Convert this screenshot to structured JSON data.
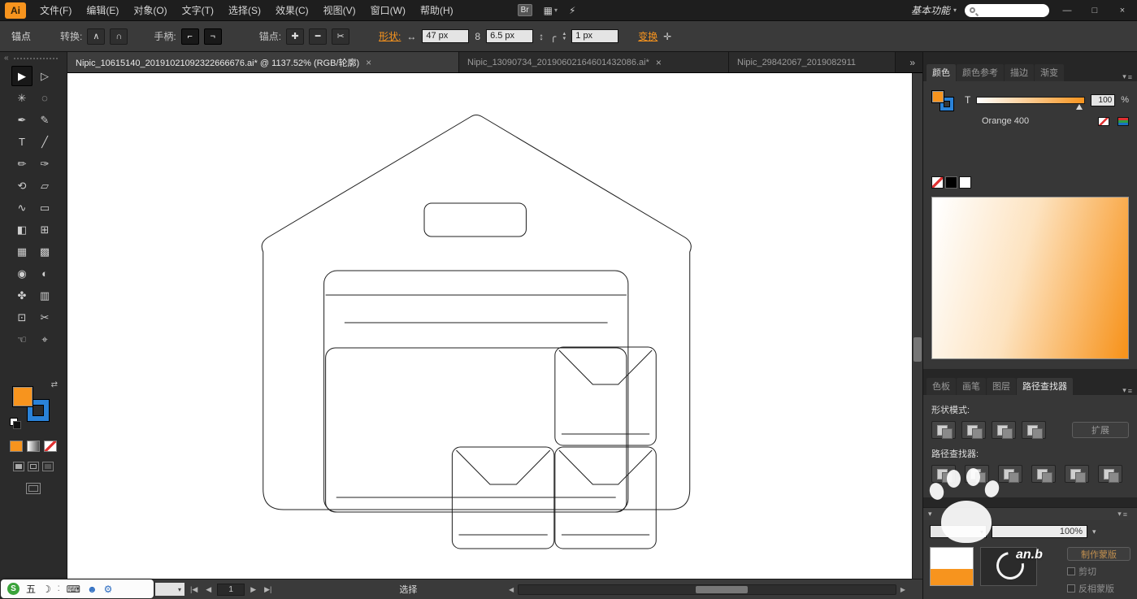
{
  "colors": {
    "accent": "#F7941E",
    "stroke_blue": "#2A82D8",
    "gradient_start": "#FFFFFF",
    "gradient_end": "#F7941E"
  },
  "menubar": {
    "logo": "Ai",
    "items": [
      "文件(F)",
      "编辑(E)",
      "对象(O)",
      "文字(T)",
      "选择(S)",
      "效果(C)",
      "视图(V)",
      "窗口(W)",
      "帮助(H)"
    ],
    "workspace_label": "基本功能"
  },
  "controlbar": {
    "context_label": "锚点",
    "convert_label": "转换:",
    "handles_label": "手柄:",
    "anchors_label": "锚点:",
    "shape_link": "形状:",
    "width_value": "47 px",
    "height_value": "6.5 px",
    "corner_value": "1 px",
    "transform_link": "变换"
  },
  "tabbar": {
    "tabs": [
      {
        "title": "Nipic_10615140_20191021092322666676.ai* @ 1137.52% (RGB/轮廓)",
        "close": "×"
      },
      {
        "title": "Nipic_13090734_20190602164601432086.ai*",
        "close": "×"
      },
      {
        "title": "Nipic_29842067_2019082911",
        "close": ""
      }
    ],
    "overflow": "»"
  },
  "toolbar": {
    "tools": [
      {
        "name": "selection",
        "glyph": "▶"
      },
      {
        "name": "direct-selection",
        "glyph": "▷"
      },
      {
        "name": "magic-wand",
        "glyph": "✳"
      },
      {
        "name": "lasso",
        "glyph": "◌"
      },
      {
        "name": "pen",
        "glyph": "✒"
      },
      {
        "name": "pencil",
        "glyph": "✎"
      },
      {
        "name": "type",
        "glyph": "T"
      },
      {
        "name": "line",
        "glyph": "╱"
      },
      {
        "name": "paintbrush",
        "glyph": "✏"
      },
      {
        "name": "blob-brush",
        "glyph": "✑"
      },
      {
        "name": "rotate",
        "glyph": "⟲"
      },
      {
        "name": "scale",
        "glyph": "▱"
      },
      {
        "name": "width",
        "glyph": "∿"
      },
      {
        "name": "free-transform",
        "glyph": "▭"
      },
      {
        "name": "shape-builder",
        "glyph": "◧"
      },
      {
        "name": "perspective-grid",
        "glyph": "⊞"
      },
      {
        "name": "mesh",
        "glyph": "▦"
      },
      {
        "name": "gradient",
        "glyph": "▩"
      },
      {
        "name": "eyedropper",
        "glyph": "◉"
      },
      {
        "name": "blend",
        "glyph": "◐"
      },
      {
        "name": "symbol-sprayer",
        "glyph": "✤"
      },
      {
        "name": "column-graph",
        "glyph": "▥"
      },
      {
        "name": "artboard",
        "glyph": "⊡"
      },
      {
        "name": "slice",
        "glyph": "✂"
      },
      {
        "name": "hand",
        "glyph": "☜"
      },
      {
        "name": "zoom",
        "glyph": "⌖"
      }
    ]
  },
  "rightpanel": {
    "top_tabs": [
      "颜色",
      "颜色参考",
      "描边",
      "渐变"
    ],
    "color": {
      "t_label": "T",
      "value": "100",
      "percent": "%",
      "swatch_name": "Orange 400"
    },
    "mid_tabs": [
      "色板",
      "画笔",
      "图层",
      "路径查找器"
    ],
    "pathfinder": {
      "shape_mode_label": "形状模式:",
      "expand_label": "扩展",
      "pathfinder_label": "路径查找器:"
    },
    "transparency": {
      "opacity_value": "100%",
      "make_mask_label": "制作蒙版",
      "clip_label": "剪切",
      "invert_label": "反相蒙版"
    }
  },
  "statusbar": {
    "selection_label": "选择",
    "artboard_value": "1"
  },
  "inputbar": {
    "sogou": "S",
    "wubi": "五"
  },
  "watermark": {
    "text": "an.b"
  },
  "icons": {
    "bridge": "Br",
    "arrange": "▦",
    "gpu": "⚡",
    "caret": "▾",
    "menu": "≡",
    "minimize": "—",
    "restore": "□",
    "close": "×",
    "collapse": "«",
    "convert_corner": "∧",
    "convert_smooth": "∩",
    "handle_a": "⌐",
    "handle_b": "¬",
    "anchor_add": "✚",
    "anchor_remove": "━",
    "anchor_cut": "✂",
    "h_arrow": "↔",
    "constrain": "8",
    "v_arrow": "↕",
    "corner_radius": "╭",
    "step_up": "▲",
    "step_down": "▼",
    "isolate": "✛",
    "swap": "⇄",
    "nav_first": "|◀",
    "nav_prev": "◀",
    "nav_next": "▶",
    "nav_last": "▶|",
    "scroll_left": "◀",
    "scroll_right": "▶",
    "moon": "☽",
    "dots": "⁚",
    "keyboard": "⌨",
    "person": "☻",
    "wrench": "⚙"
  }
}
